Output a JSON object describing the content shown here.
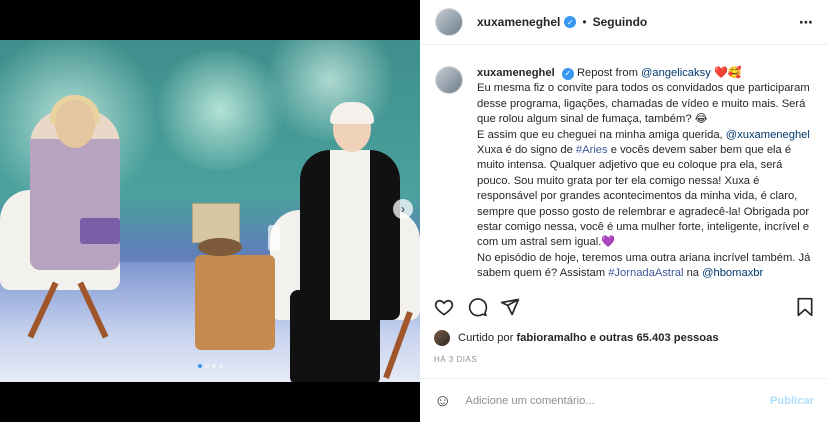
{
  "header": {
    "username": "xuxameneghel",
    "follow_label": "Seguindo",
    "more_icon": "⋯",
    "separator": "•"
  },
  "caption": {
    "username": "xuxameneghel",
    "repost_prefix": "Repost from",
    "repost_user": "@angelicaksy",
    "emojis": "❤️🥰",
    "p1": "Eu mesma fiz o convite para todos os convidados que participaram desse programa, ligações, chamadas de vídeo e muito mais. Será que rolou algum sinal de fumaça, também? 😂",
    "p2_a": "E assim que eu cheguei na minha amiga querida,",
    "p2_mention": "@xuxameneghel",
    "p2_b": "Xuxa é do signo de",
    "p2_tag": "#Aries",
    "p2_c": "e vocês devem saber bem que ela é muito intensa. Qualquer adjetivo que eu coloque pra ela, será pouco. Sou muito grata por ter ela comigo nessa! Xuxa é responsável por grandes acontecimentos da minha vida, é claro, sempre que posso gosto de relembrar e agradecê-la! Obrigada por estar comigo nessa, você é uma mulher forte, inteligente, incrível e com um astral sem igual.💜",
    "p3_a": "No episódio de hoje, teremos uma outra ariana incrível também. Já sabem quem é? Assistam",
    "p3_tag": "#JornadaAstral",
    "p3_mid": "na",
    "p3_mention": "@hbomaxbr"
  },
  "likes": {
    "prefix": "Curtido por",
    "user": "fabioramalho",
    "suffix": "e outras 65.403 pessoas"
  },
  "timestamp": "HÁ 3 DIAS",
  "comment": {
    "placeholder": "Adicione um comentário...",
    "publish_label": "Publicar"
  },
  "carousel": {
    "total_slides": 4,
    "active_slide": 1
  },
  "colors": {
    "link": "#00376b",
    "hashtag": "#3b5998",
    "verified": "#3897f0",
    "publish_disabled": "#b2dffc"
  },
  "icons": [
    "like-icon",
    "comment-icon",
    "share-icon",
    "save-icon",
    "emoji-icon",
    "verified-icon",
    "next-arrow-icon"
  ]
}
